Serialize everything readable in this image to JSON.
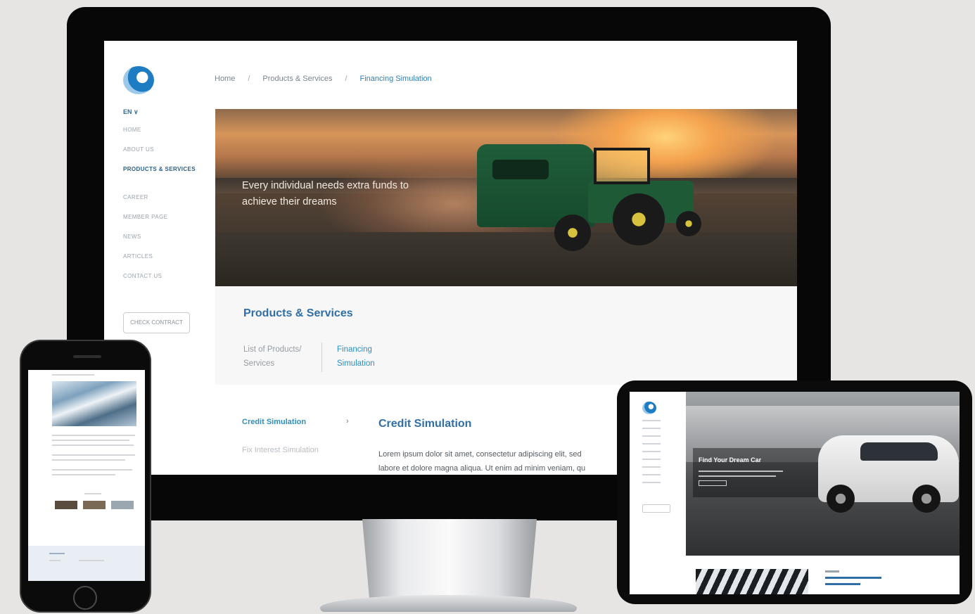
{
  "desktop": {
    "sidebar": {
      "lang": "EN ∨",
      "items": [
        {
          "label": "HOME"
        },
        {
          "label": "ABOUT US"
        },
        {
          "label": "PRODUCTS & SERVICES"
        },
        {
          "label": "CAREER"
        },
        {
          "label": "MEMBER PAGE"
        },
        {
          "label": "NEWS"
        },
        {
          "label": "ARTICLES"
        },
        {
          "label": "CONTACT US"
        }
      ],
      "button_label": "CHECK CONTRACT"
    },
    "breadcrumb": {
      "home": "Home",
      "sep1": "/",
      "section": "Products & Services",
      "sep2": "/",
      "current": "Financing Simulation"
    },
    "hero_text": "Every individual needs extra funds to achieve their dreams",
    "products_panel": {
      "title": "Products & Services",
      "list_label": "List of Products/ Services",
      "active_label": "Financing Simulation"
    },
    "simulation": {
      "side_active": "Credit Simulation",
      "arrow": "›",
      "side_inactive": "Fix Interest Simulation",
      "title": "Credit Simulation",
      "body_line1": "Lorem ipsum dolor sit amet, consectetur adipiscing elit, sed",
      "body_line2": "labore et dolore magna aliqua. Ut enim ad minim veniam, qu"
    }
  },
  "tablet": {
    "hero_title": "Find Your Dream Car"
  },
  "colors": {
    "accent": "#2f6fa6",
    "link": "#2f8fc2",
    "background": "#e6e5e3"
  }
}
